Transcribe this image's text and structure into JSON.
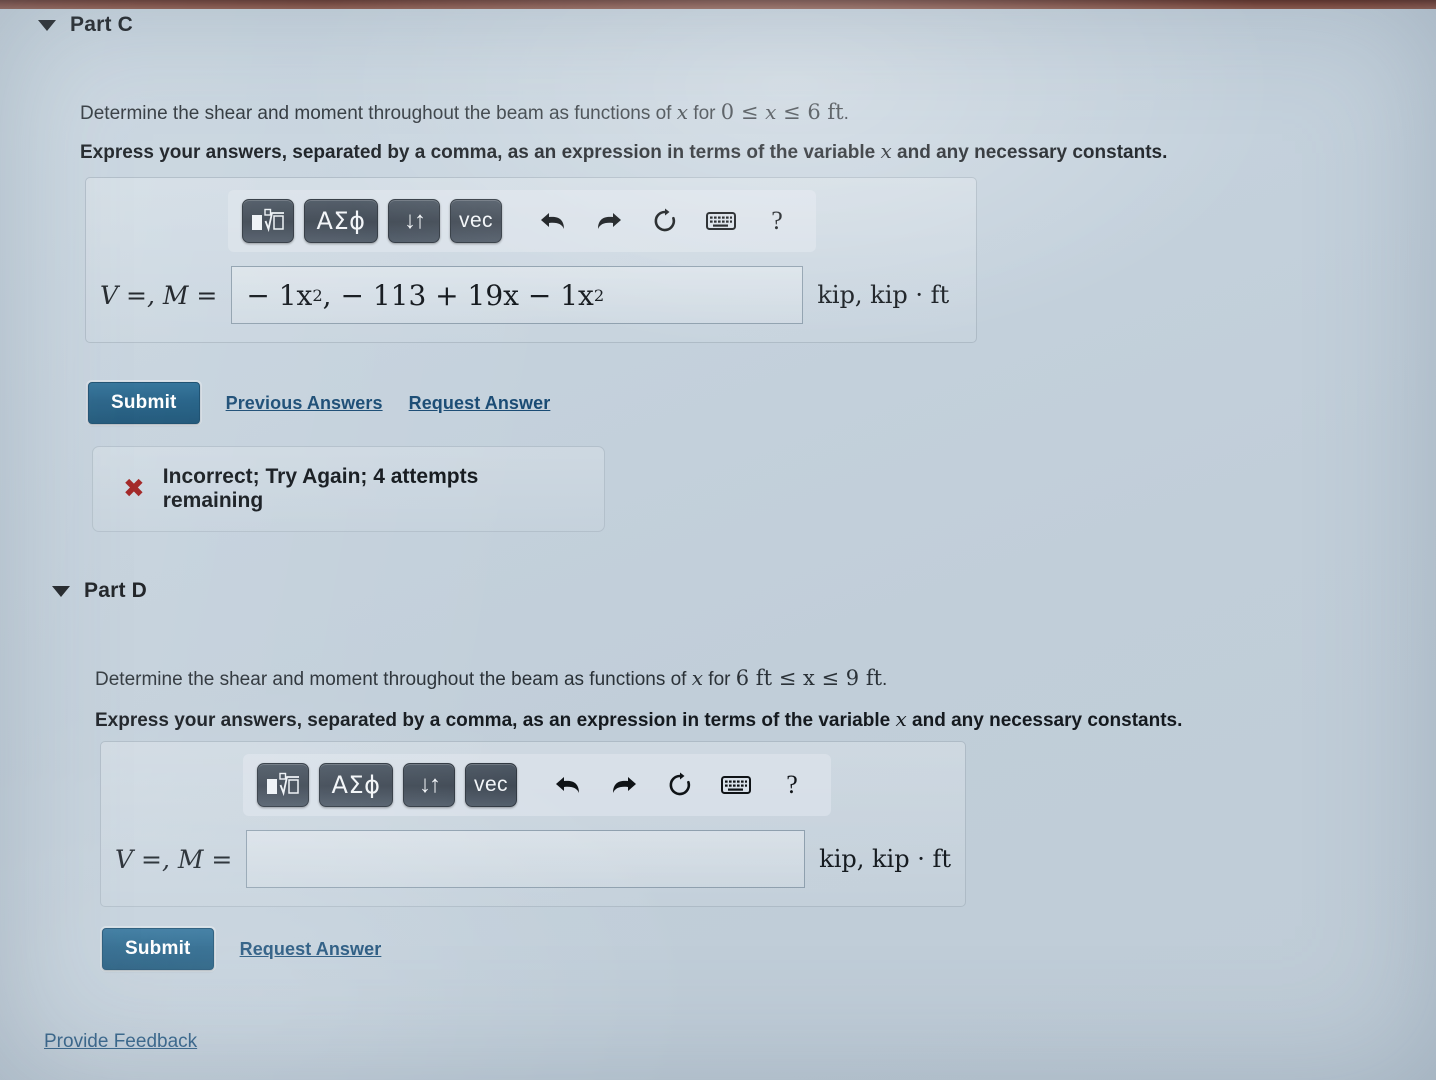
{
  "parts": [
    {
      "id": "part-c",
      "title": "Part C",
      "caret": "caret-down-icon",
      "prompt": {
        "lead": "Determine the shear and moment throughout the beam as functions of ",
        "var1": "x",
        "mid": " for ",
        "range": "0 ≤ x ≤ 6",
        "range_low": "0",
        "range_var": "x",
        "range_high": "6",
        "unit": "ft",
        "trail": "."
      },
      "instruction": {
        "pre": "Express your answers, separated by a comma, as an expression in terms of the variable ",
        "var": "x",
        "post": " and any necessary constants."
      },
      "toolbar": {
        "buttons": [
          {
            "name": "math-template-button",
            "glyph": "■√□",
            "kind": "template"
          },
          {
            "name": "greek-symbols-button",
            "glyph": "ΑΣϕ",
            "kind": "greek"
          },
          {
            "name": "subscript-superscript-button",
            "glyph": "↓↑",
            "kind": "arrows"
          },
          {
            "name": "vector-button",
            "glyph": "vec",
            "kind": "vec"
          }
        ],
        "plain": [
          {
            "name": "undo-icon",
            "glyph": "↶"
          },
          {
            "name": "redo-icon",
            "glyph": "↷"
          },
          {
            "name": "reset-icon",
            "glyph": "↻"
          },
          {
            "name": "keyboard-icon",
            "glyph": "⌨"
          },
          {
            "name": "help-icon",
            "glyph": "?"
          }
        ]
      },
      "answer": {
        "label": "V =, M =",
        "value": "− 1x², − 113 + 19x − 1x²",
        "value_parts": [
          "− 1x",
          "2",
          ", − 113 + 19x − 1x",
          "2"
        ],
        "placeholder": "",
        "units": "kip, kip · ft"
      },
      "actions": {
        "submit_label": "Submit",
        "links": [
          "Previous Answers",
          "Request Answer"
        ]
      },
      "feedback": {
        "icon": "x-mark-icon",
        "icon_color": "#9e1b1b",
        "text": "Incorrect; Try Again; 4 attempts remaining"
      }
    },
    {
      "id": "part-d",
      "title": "Part D",
      "caret": "caret-down-icon",
      "prompt": {
        "lead": "Determine the shear and moment throughout the beam as functions of ",
        "var1": "x",
        "mid": " for ",
        "range_low": "6 ft",
        "range_var": "x",
        "range_high": "9",
        "unit": "ft",
        "trail": "."
      },
      "instruction": {
        "pre": "Express your answers, separated by a comma, as an expression in terms of the variable ",
        "var": "x",
        "post": " and any necessary constants."
      },
      "toolbar": {
        "buttons": [
          {
            "name": "math-template-button",
            "glyph": "■√□",
            "kind": "template"
          },
          {
            "name": "greek-symbols-button",
            "glyph": "ΑΣϕ",
            "kind": "greek"
          },
          {
            "name": "subscript-superscript-button",
            "glyph": "↓↑",
            "kind": "arrows"
          },
          {
            "name": "vector-button",
            "glyph": "vec",
            "kind": "vec"
          }
        ],
        "plain": [
          {
            "name": "undo-icon",
            "glyph": "↶"
          },
          {
            "name": "redo-icon",
            "glyph": "↷"
          },
          {
            "name": "reset-icon",
            "glyph": "↻"
          },
          {
            "name": "keyboard-icon",
            "glyph": "⌨"
          },
          {
            "name": "help-icon",
            "glyph": "?"
          }
        ]
      },
      "answer": {
        "label": "V =, M =",
        "value": "",
        "placeholder": "",
        "units": "kip, kip · ft"
      },
      "actions": {
        "submit_label": "Submit",
        "links": [
          "Request Answer"
        ]
      },
      "feedback": null
    }
  ],
  "footer": {
    "provide_feedback_label": "Provide Feedback"
  },
  "colors": {
    "page_background": "#c4d1dc",
    "submit_button": "#1d5c83",
    "link": "#184a73",
    "error": "#9e1b1b",
    "top_band": "#7a4234"
  }
}
